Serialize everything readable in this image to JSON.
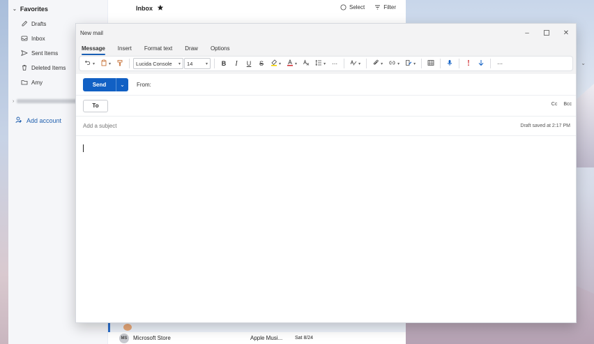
{
  "sidebar": {
    "favorites_label": "Favorites",
    "items": [
      {
        "label": "Drafts",
        "icon": "pencil-icon"
      },
      {
        "label": "Inbox",
        "icon": "inbox-icon"
      },
      {
        "label": "Sent Items",
        "icon": "send-icon"
      },
      {
        "label": "Deleted Items",
        "icon": "trash-icon"
      },
      {
        "label": "Amy",
        "icon": "folder-icon"
      }
    ],
    "add_account_label": "Add account"
  },
  "message_list": {
    "title": "Inbox",
    "select_label": "Select",
    "filter_label": "Filter",
    "bottom_row": {
      "initials": "MS",
      "sender": "Microsoft Store",
      "subject": "Apple Musi...",
      "date": "Sat 8/24"
    }
  },
  "compose": {
    "window_title": "New mail",
    "tabs": [
      "Message",
      "Insert",
      "Format text",
      "Draw",
      "Options"
    ],
    "active_tab": "Message",
    "font_name": "Lucida Console",
    "font_size": "14",
    "send_label": "Send",
    "from_label": "From:",
    "to_label": "To",
    "cc_label": "Cc",
    "bcc_label": "Bcc",
    "subject_placeholder": "Add a subject",
    "draft_status": "Draft saved at 2:17 PM"
  },
  "colors": {
    "accent": "#1160c4",
    "tab_underline": "#1a5fb4"
  }
}
